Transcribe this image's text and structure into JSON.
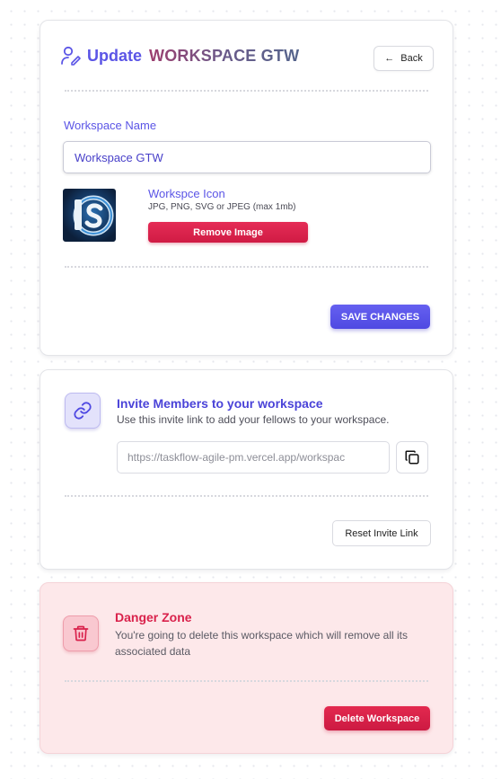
{
  "update_card": {
    "title_prefix": "Update",
    "workspace_title": "WORKSPACE GTW",
    "back_label": "Back",
    "name_label": "Workspace Name",
    "name_value": "Workspace GTW",
    "icon_title": "Workspce Icon",
    "icon_hint": "JPG, PNG, SVG or JPEG (max 1mb)",
    "remove_label": "Remove Image",
    "save_label": "SAVE CHANGES"
  },
  "invite_card": {
    "title": "Invite Members to your workspace",
    "subtitle": "Use this invite link to add your fellows to your workspace.",
    "link_value": "https://taskflow-agile-pm.vercel.app/workspac",
    "reset_label": "Reset Invite Link"
  },
  "danger_card": {
    "title": "Danger Zone",
    "subtitle": "You're going to delete this workspace which will remove all its associated data",
    "delete_label": "Delete Workspace"
  },
  "colors": {
    "primary": "#5b55e6",
    "danger": "#d9214b",
    "danger_bg": "#fde8ea"
  },
  "icons": [
    "user-edit-icon",
    "arrow-left-icon",
    "workspace-logo",
    "link-icon",
    "copy-icon",
    "trash-icon"
  ]
}
